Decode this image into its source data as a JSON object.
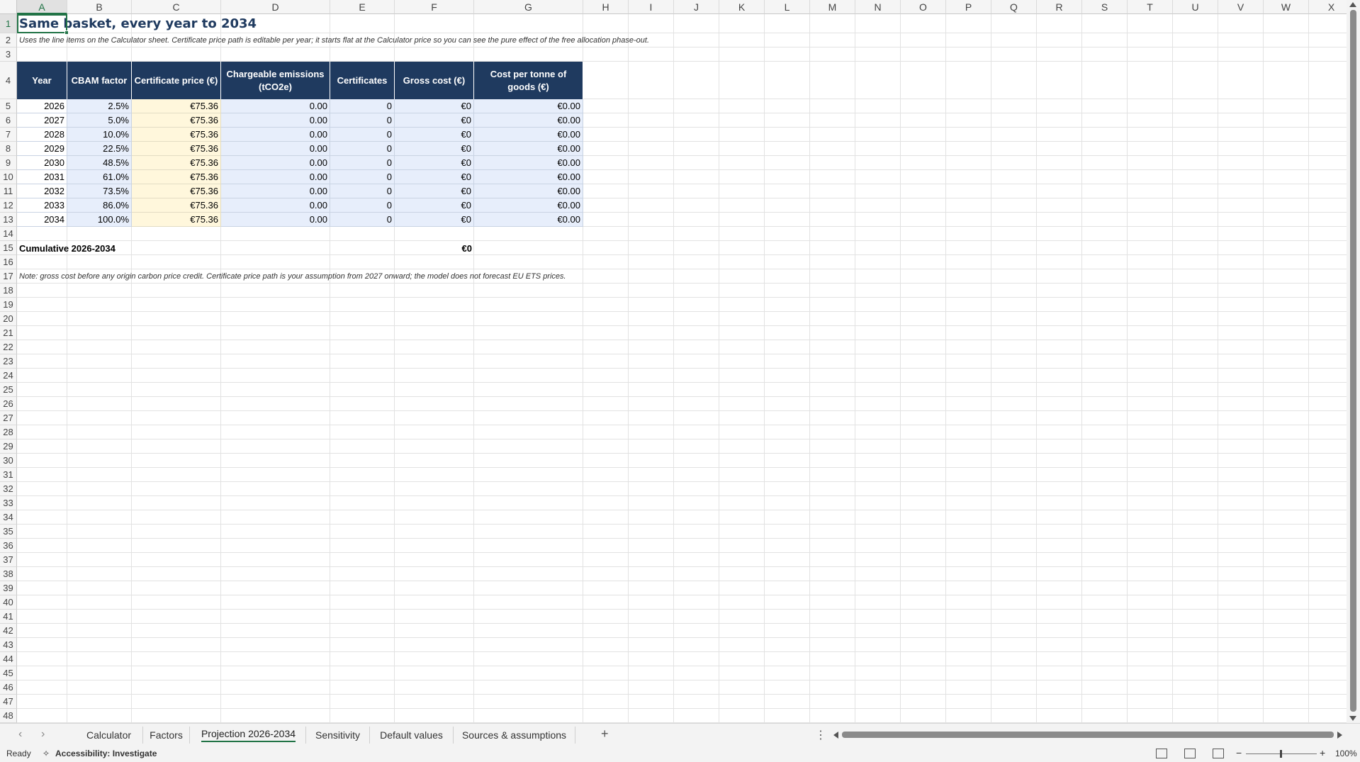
{
  "columns": [
    "A",
    "B",
    "C",
    "D",
    "E",
    "F",
    "G",
    "H",
    "I",
    "J",
    "K",
    "L",
    "M",
    "N",
    "O",
    "P",
    "Q",
    "R",
    "S",
    "T",
    "U",
    "V",
    "W",
    "X"
  ],
  "rows": [
    "1",
    "2",
    "3",
    "4",
    "5",
    "6",
    "7",
    "8",
    "9",
    "10",
    "11",
    "12",
    "13",
    "14",
    "15",
    "16",
    "17",
    "18",
    "19",
    "20",
    "21",
    "22",
    "23",
    "24",
    "25",
    "26",
    "27",
    "28",
    "29",
    "30",
    "31",
    "32",
    "33",
    "34",
    "35",
    "36",
    "37",
    "38",
    "39",
    "40",
    "41",
    "42",
    "43",
    "44",
    "45",
    "46",
    "47",
    "48"
  ],
  "sheet": {
    "title": "Same basket, every year to 2034",
    "subtitle": "Uses the line items on the Calculator sheet. Certificate price path is editable per year; it starts flat at the Calculator price so you can see the pure effect of the free allocation phase-out.",
    "headers": [
      "Year",
      "CBAM factor",
      "Certificate price (€)",
      "Chargeable emissions (tCO2e)",
      "Certificates",
      "Gross cost (€)",
      "Cost per tonne of goods (€)"
    ],
    "table": [
      [
        "2026",
        "2.5%",
        "€75.36",
        "0.00",
        "0",
        "€0",
        "€0.00"
      ],
      [
        "2027",
        "5.0%",
        "€75.36",
        "0.00",
        "0",
        "€0",
        "€0.00"
      ],
      [
        "2028",
        "10.0%",
        "€75.36",
        "0.00",
        "0",
        "€0",
        "€0.00"
      ],
      [
        "2029",
        "22.5%",
        "€75.36",
        "0.00",
        "0",
        "€0",
        "€0.00"
      ],
      [
        "2030",
        "48.5%",
        "€75.36",
        "0.00",
        "0",
        "€0",
        "€0.00"
      ],
      [
        "2031",
        "61.0%",
        "€75.36",
        "0.00",
        "0",
        "€0",
        "€0.00"
      ],
      [
        "2032",
        "73.5%",
        "€75.36",
        "0.00",
        "0",
        "€0",
        "€0.00"
      ],
      [
        "2033",
        "86.0%",
        "€75.36",
        "0.00",
        "0",
        "€0",
        "€0.00"
      ],
      [
        "2034",
        "100.0%",
        "€75.36",
        "0.00",
        "0",
        "€0",
        "€0.00"
      ]
    ],
    "cumulative_label": "Cumulative 2026-2034",
    "cumulative_value": "€0",
    "note": "Note: gross cost before any origin carbon price credit. Certificate price path is your assumption from 2027 onward; the model does not forecast EU ETS prices."
  },
  "tabs": [
    "Calculator",
    "Factors",
    "Projection 2026-2034",
    "Sensitivity",
    "Default values",
    "Sources & assumptions"
  ],
  "active_tab": "Projection 2026-2034",
  "status": {
    "ready": "Ready",
    "accessibility": "Accessibility: Investigate",
    "zoom": "100%"
  },
  "icons": {
    "tab_prev": "chevron-left-icon",
    "tab_next": "chevron-right-icon",
    "add_sheet": "plus-icon",
    "more": "more-vertical-icon",
    "accessibility": "accessibility-icon",
    "normal_view": "grid-view-icon",
    "page_layout": "page-layout-icon",
    "page_break": "page-break-icon"
  },
  "colors": {
    "header_fill": "#1f3a5f",
    "input_fill": "#fff7dc",
    "calc_fill": "#e7eefb",
    "excel_green": "#217346"
  }
}
